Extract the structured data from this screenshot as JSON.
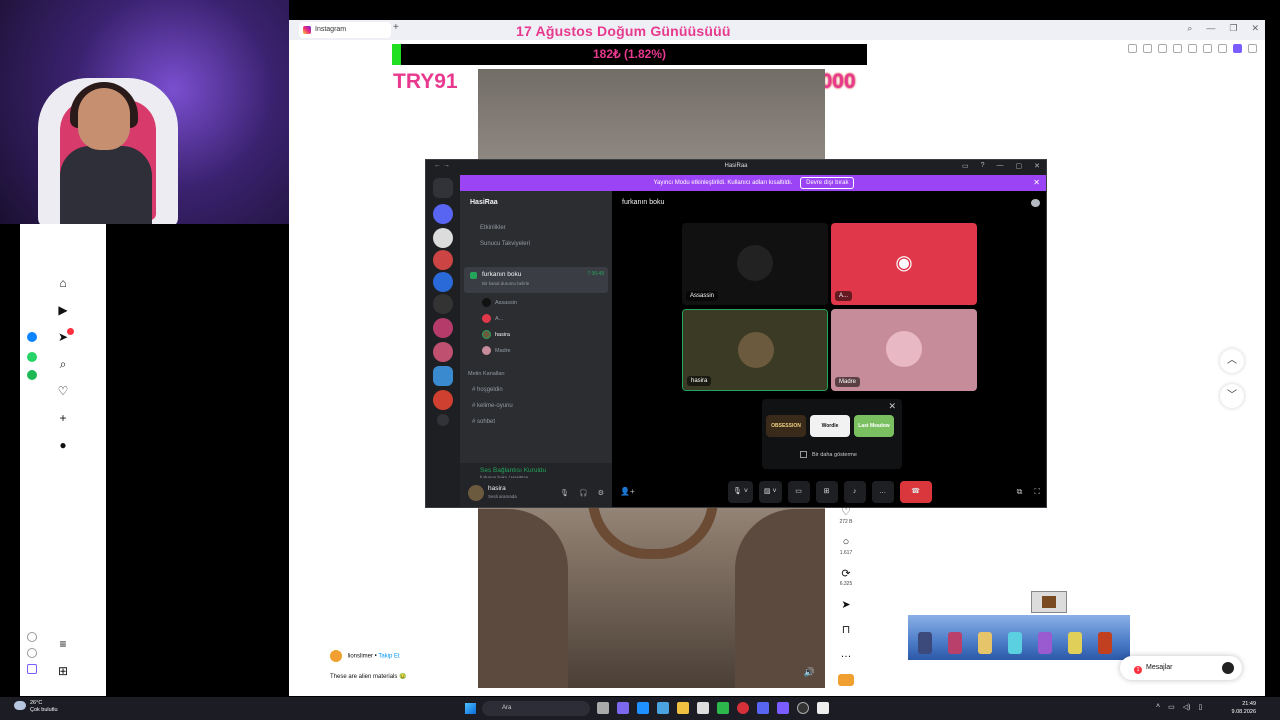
{
  "browser": {
    "tab_title": "Instagram",
    "new_tab": "+",
    "window_buttons": [
      "—",
      "❐",
      "✕"
    ]
  },
  "overlay": {
    "birthday_title": "17 Ağustos Doğum Günüüsüüü",
    "goal_text": "182₺ (1.82%)",
    "goal_progress": 0.0182,
    "amount_current": "TRY91",
    "amount_goal": "TRY10000",
    "colors": {
      "pink": "#e8398f",
      "green": "#21e021"
    }
  },
  "reel": {
    "likes": "272 B",
    "comments": "1.617",
    "shares": "6.325",
    "author": "lionslimer",
    "follow": "Takip Et",
    "caption": "These are alien materials 🤢"
  },
  "messages": {
    "label": "Mesajlar",
    "badge": "1"
  },
  "discord": {
    "title": "HasiRaa",
    "banner_text": "Yayıncı Modu etkinleştirildi. Kullanıcı adları kısaltıldı.",
    "banner_button": "Devre dışı bırak",
    "server_name": "HasiRaa",
    "menu_items": [
      "Etkinlikler",
      "Sunucu Takviyeleri"
    ],
    "voice_channel": {
      "name": "furkanın boku",
      "status": "Bir kanal durumu belirle",
      "time": "7:36:48"
    },
    "members": [
      "Assassin",
      "A...",
      "hasira",
      "Madre"
    ],
    "text_category": "Metin Kanalları",
    "text_channels": [
      "hoşgeldin",
      "kelime-oyunu",
      "sohbet"
    ],
    "connection": {
      "title": "Ses Bağlantısı Kuruldu",
      "subtitle": "furkanın boku / HasiRaa"
    },
    "user": {
      "name": "hasira",
      "status": "Sesli aramada"
    },
    "stage_header": "furkanın boku",
    "tiles": [
      {
        "label": "Assassin",
        "bg": "#111111"
      },
      {
        "label": "A...",
        "bg": "#e0384a"
      },
      {
        "label": "hasira",
        "bg": "#3a3a25"
      },
      {
        "label": "Madre",
        "bg": "#c78c9a"
      }
    ],
    "activities": {
      "items": [
        "OBSESSION",
        "Wordle",
        "Last Meadow"
      ],
      "dont_show": "Bir daha gösterme"
    }
  },
  "taskbar": {
    "weather_temp": "26°C",
    "weather_desc": "Çok bulutlu",
    "search_placeholder": "Ara",
    "time": "21:49",
    "date": "9.08.2026"
  }
}
